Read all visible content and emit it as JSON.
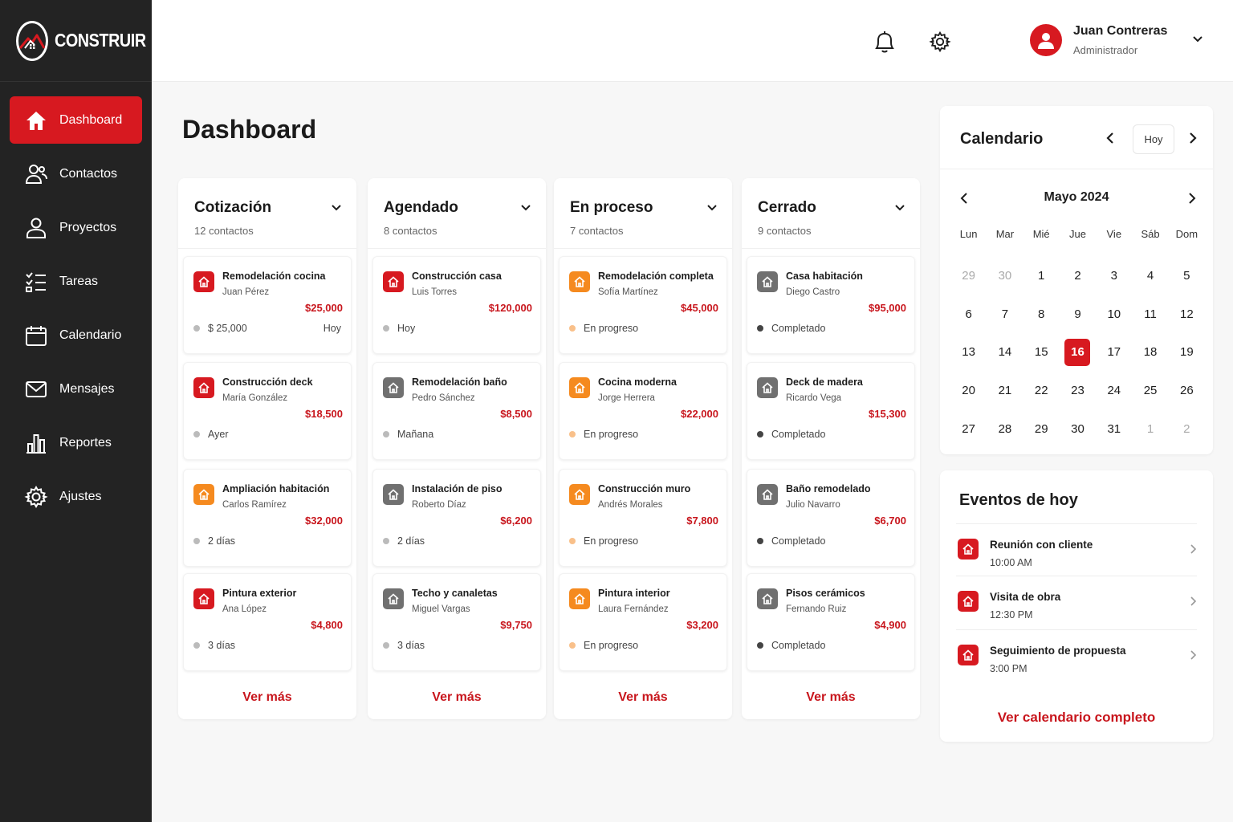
{
  "brand": {
    "name": "CONSTRUIR"
  },
  "colors": {
    "accent": "#d71920",
    "sidebar": "#232323",
    "orange": "#f58a1f",
    "gray": "#707070"
  },
  "sidebar": {
    "items": [
      {
        "label": "Dashboard",
        "icon": "home-icon",
        "active": true
      },
      {
        "label": "Contactos",
        "icon": "users-icon"
      },
      {
        "label": "Proyectos",
        "icon": "user-icon"
      },
      {
        "label": "Tareas",
        "icon": "checklist-icon"
      },
      {
        "label": "Calendario",
        "icon": "calendar-icon"
      },
      {
        "label": "Mensajes",
        "icon": "mail-icon"
      },
      {
        "label": "Reportes",
        "icon": "bar-chart-icon"
      },
      {
        "label": "Ajustes",
        "icon": "gear-icon"
      }
    ]
  },
  "header": {
    "user_name": "Juan Contreras",
    "user_role": "Administrador"
  },
  "page_title": "Dashboard",
  "see_more_label": "Ver más",
  "columns": [
    {
      "title": "Cotización",
      "count": "12 contactos",
      "cards": [
        {
          "title": "Remodelación cocina",
          "client": "Juan Pérez",
          "amount": "$25,000",
          "status": "$ 25,000",
          "date": "Hoy",
          "icon_color": "red"
        },
        {
          "title": "Construcción deck",
          "client": "María González",
          "amount": "$18,500",
          "status": "Ayer",
          "date": "",
          "icon_color": "red"
        },
        {
          "title": "Ampliación habitación",
          "client": "Carlos Ramírez",
          "amount": "$32,000",
          "status": "2 días",
          "date": "",
          "icon_color": "orange"
        },
        {
          "title": "Pintura exterior",
          "client": "Ana López",
          "amount": "$4,800",
          "status": "3 días",
          "date": "",
          "icon_color": "red"
        }
      ]
    },
    {
      "title": "Agendado",
      "count": "8 contactos",
      "cards": [
        {
          "title": "Construcción casa",
          "client": "Luis Torres",
          "amount": "$120,000",
          "status": "Hoy",
          "date": "",
          "icon_color": "red"
        },
        {
          "title": "Remodelación baño",
          "client": "Pedro Sánchez",
          "amount": "$8,500",
          "status": "Mañana",
          "date": "",
          "icon_color": "gray"
        },
        {
          "title": "Instalación de piso",
          "client": "Roberto Díaz",
          "amount": "$6,200",
          "status": "2 días",
          "date": "",
          "icon_color": "gray"
        },
        {
          "title": "Techo y canaletas",
          "client": "Miguel Vargas",
          "amount": "$9,750",
          "status": "3 días",
          "date": "",
          "icon_color": "gray"
        }
      ]
    },
    {
      "title": "En proceso",
      "count": "7 contactos",
      "cards": [
        {
          "title": "Remodelación completa",
          "client": "Sofía Martínez",
          "amount": "$45,000",
          "status": "En progreso",
          "date": "",
          "icon_color": "orange"
        },
        {
          "title": "Cocina moderna",
          "client": "Jorge Herrera",
          "amount": "$22,000",
          "status": "En progreso",
          "date": "",
          "icon_color": "orange"
        },
        {
          "title": "Construcción muro",
          "client": "Andrés Morales",
          "amount": "$7,800",
          "status": "En progreso",
          "date": "",
          "icon_color": "orange"
        },
        {
          "title": "Pintura interior",
          "client": "Laura Fernández",
          "amount": "$3,200",
          "status": "En progreso",
          "date": "",
          "icon_color": "orange"
        }
      ]
    },
    {
      "title": "Cerrado",
      "count": "9 contactos",
      "cards": [
        {
          "title": "Casa habitación",
          "client": "Diego Castro",
          "amount": "$95,000",
          "status": "Completado",
          "date": "",
          "icon_color": "gray"
        },
        {
          "title": "Deck de madera",
          "client": "Ricardo Vega",
          "amount": "$15,300",
          "status": "Completado",
          "date": "",
          "icon_color": "gray"
        },
        {
          "title": "Baño remodelado",
          "client": "Julio Navarro",
          "amount": "$6,700",
          "status": "Completado",
          "date": "",
          "icon_color": "gray"
        },
        {
          "title": "Pisos cerámicos",
          "client": "Fernando Ruiz",
          "amount": "$4,900",
          "status": "Completado",
          "date": "",
          "icon_color": "gray"
        }
      ]
    }
  ],
  "calendar": {
    "title": "Calendario",
    "today_label": "Hoy",
    "month_label": "Mayo 2024",
    "weekdays": [
      "Lun",
      "Mar",
      "Mié",
      "Jue",
      "Vie",
      "Sáb",
      "Dom"
    ],
    "days": [
      {
        "n": "29",
        "muted": true
      },
      {
        "n": "30",
        "muted": true
      },
      {
        "n": "1"
      },
      {
        "n": "2"
      },
      {
        "n": "3"
      },
      {
        "n": "4"
      },
      {
        "n": "5"
      },
      {
        "n": "6"
      },
      {
        "n": "7"
      },
      {
        "n": "8"
      },
      {
        "n": "9"
      },
      {
        "n": "10"
      },
      {
        "n": "11"
      },
      {
        "n": "12"
      },
      {
        "n": "13"
      },
      {
        "n": "14"
      },
      {
        "n": "15"
      },
      {
        "n": "16",
        "today": true
      },
      {
        "n": "17"
      },
      {
        "n": "18"
      },
      {
        "n": "19"
      },
      {
        "n": "20"
      },
      {
        "n": "21"
      },
      {
        "n": "22"
      },
      {
        "n": "23"
      },
      {
        "n": "24"
      },
      {
        "n": "25"
      },
      {
        "n": "26"
      },
      {
        "n": "27"
      },
      {
        "n": "28"
      },
      {
        "n": "29"
      },
      {
        "n": "30"
      },
      {
        "n": "31"
      },
      {
        "n": "1",
        "muted": true
      },
      {
        "n": "2",
        "muted": true
      }
    ]
  },
  "events": {
    "title": "Eventos de hoy",
    "items": [
      {
        "title": "Reunión con cliente",
        "time": "10:00 AM"
      },
      {
        "title": "Visita de obra",
        "time": "12:30 PM"
      },
      {
        "title": "Seguimiento de propuesta",
        "time": "3:00 PM"
      }
    ],
    "link_label": "Ver calendario completo"
  }
}
